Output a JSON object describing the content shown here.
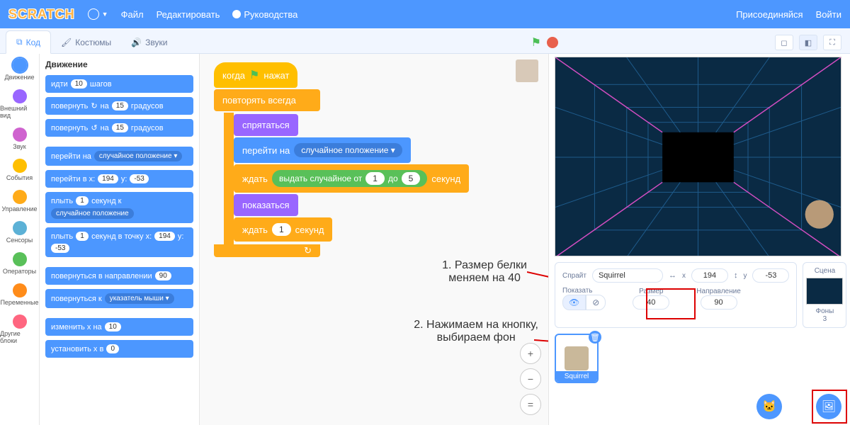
{
  "topbar": {
    "file": "Файл",
    "edit": "Редактировать",
    "tutorials": "Руководства",
    "join": "Присоединяйся",
    "signin": "Войти"
  },
  "tabs": {
    "code": "Код",
    "costumes": "Костюмы",
    "sounds": "Звуки"
  },
  "categories": [
    {
      "label": "Движение",
      "color": "#4c97ff"
    },
    {
      "label": "Внешний вид",
      "color": "#9966ff"
    },
    {
      "label": "Звук",
      "color": "#cf63cf"
    },
    {
      "label": "События",
      "color": "#ffbf00"
    },
    {
      "label": "Управление",
      "color": "#ffab19"
    },
    {
      "label": "Сенсоры",
      "color": "#5cb1d6"
    },
    {
      "label": "Операторы",
      "color": "#59c059"
    },
    {
      "label": "Переменные",
      "color": "#ff8c1a"
    },
    {
      "label": "Другие блоки",
      "color": "#ff6680"
    }
  ],
  "palette": {
    "heading": "Движение",
    "blocks": {
      "move_a": "идти",
      "move_b": "шагов",
      "move_v": "10",
      "turn_r_a": "повернуть",
      "turn_r_b": "на",
      "turn_r_c": "градусов",
      "turn_r_v": "15",
      "turn_l_a": "повернуть",
      "turn_l_b": "на",
      "turn_l_c": "градусов",
      "turn_l_v": "15",
      "goto_a": "перейти на",
      "goto_slot": "случайное положение ▾",
      "gotoxy_a": "перейти в x:",
      "gotoxy_x": "194",
      "gotoxy_b": "y:",
      "gotoxy_y": "-53",
      "glide_a": "плыть",
      "glide_v": "1",
      "glide_b": "секунд к",
      "glide_slot": "случайное положение",
      "glidexy_a": "плыть",
      "glidexy_v": "1",
      "glidexy_b": "секунд в точку x:",
      "glidexy_x": "194",
      "glidexy_c": "y:",
      "glidexy_y": "-53",
      "point_a": "повернуться в направлении",
      "point_v": "90",
      "point_to_a": "повернуться к",
      "point_to_slot": "указатель мыши ▾",
      "changex_a": "изменить x на",
      "changex_v": "10",
      "setx_a": "установить x в",
      "setx_v": "0"
    }
  },
  "script": {
    "when_a": "когда",
    "when_b": "нажат",
    "forever": "повторять всегда",
    "hide": "спрятаться",
    "goto_a": "перейти на",
    "goto_slot": "случайное положение ▾",
    "wait_a": "ждать",
    "wait_b": "секунд",
    "rand_a": "выдать случайное от",
    "rand_b": "до",
    "rand_lo": "1",
    "rand_hi": "5",
    "show": "показаться",
    "wait2_v": "1"
  },
  "annotations": {
    "line1": "1. Размер белки",
    "line1b": "меняем на 40",
    "line2": "2. Нажимаем на кнопку,",
    "line2b": "выбираем фон"
  },
  "spriteinfo": {
    "title": "Спрайт",
    "name": "Squirrel",
    "x_lbl": "x",
    "x": "194",
    "y_lbl": "y",
    "y": "-53",
    "show_lbl": "Показать",
    "size_lbl": "Размер",
    "size": "40",
    "dir_lbl": "Направление",
    "dir": "90"
  },
  "scene": {
    "title": "Сцена",
    "backs_lbl": "Фоны",
    "backs_n": "3"
  },
  "spritelist": {
    "name": "Squirrel"
  }
}
